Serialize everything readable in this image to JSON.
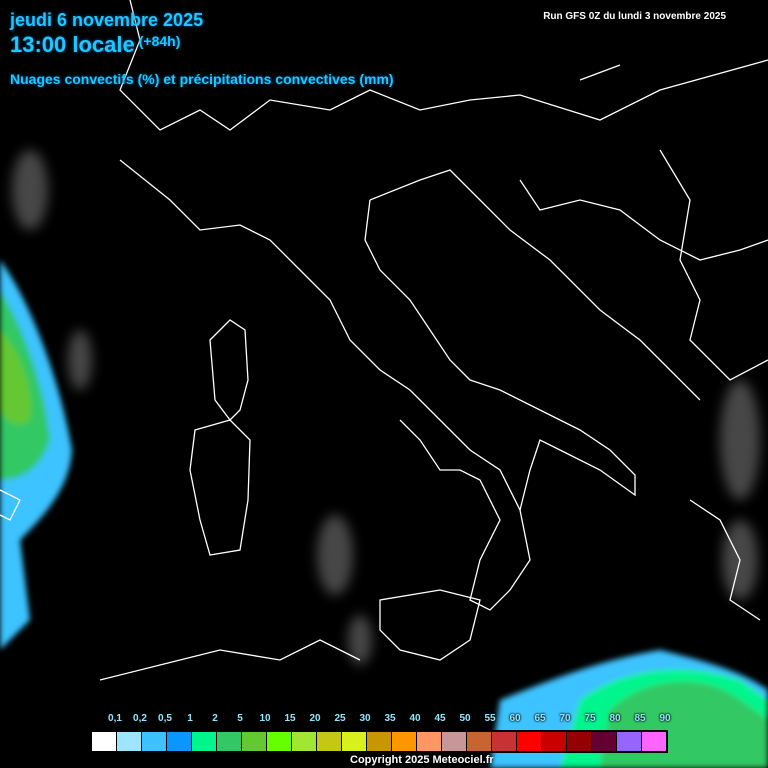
{
  "header": {
    "date": "jeudi 6 novembre 2025",
    "time": "13:00 locale",
    "lead": "(+84h)",
    "subtitle": "Nuages convectifs (%) et précipitations convectives (mm)",
    "run": "Run GFS 0Z du lundi 3 novembre 2025"
  },
  "legend": {
    "labels": [
      "0,1",
      "0,2",
      "0,5",
      "1",
      "2",
      "5",
      "10",
      "15",
      "20",
      "25",
      "30",
      "35",
      "40",
      "45",
      "50",
      "55",
      "60",
      "65",
      "70",
      "75",
      "80",
      "85",
      "90"
    ],
    "colors": [
      "#ffffff",
      "#9ee5ff",
      "#3cc3ff",
      "#0a96ff",
      "#00f58c",
      "#32c864",
      "#64c832",
      "#64ff00",
      "#a0e632",
      "#c3c814",
      "#d7f01e",
      "#c89600",
      "#ff9600",
      "#ff9664",
      "#c89696",
      "#c86432",
      "#c83232",
      "#ff0000",
      "#c80000",
      "#960000",
      "#640032",
      "#9664ff",
      "#ff64ff"
    ]
  },
  "copyright": "Copyright 2025 Meteociel.fr"
}
